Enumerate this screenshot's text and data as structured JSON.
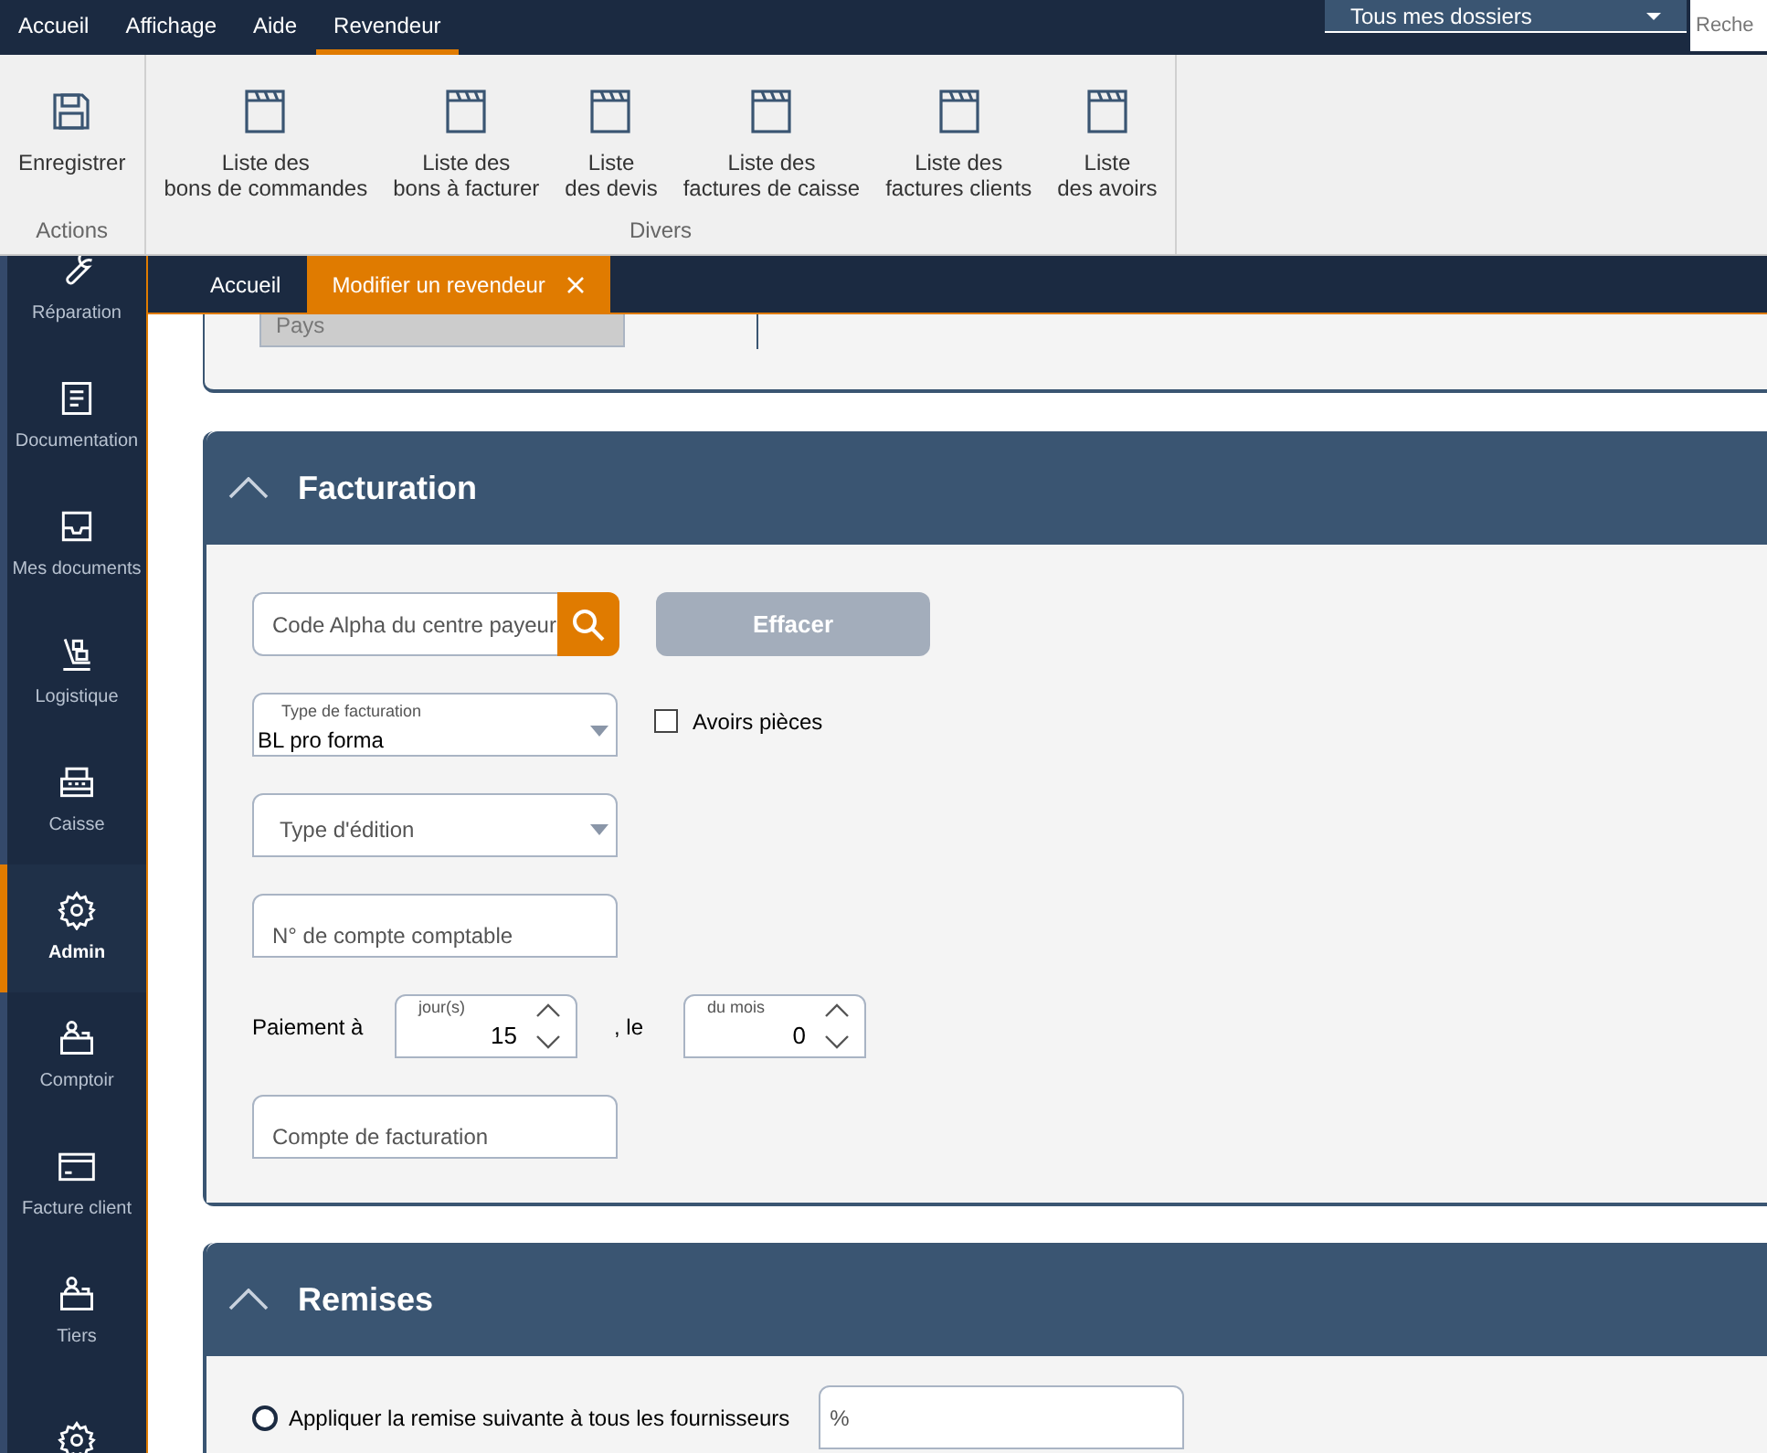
{
  "menu": [
    {
      "label": "Accueil",
      "selected": false
    },
    {
      "label": "Affichage",
      "selected": false
    },
    {
      "label": "Aide",
      "selected": false
    },
    {
      "label": "Revendeur",
      "selected": true
    }
  ],
  "folder_select": {
    "value": "Tous mes dossiers"
  },
  "search": {
    "placeholder": "Reche"
  },
  "ribbon": {
    "groups": [
      {
        "label": "Actions",
        "items": [
          {
            "kind": "save",
            "label": "Enregistrer"
          }
        ]
      },
      {
        "label": "Divers",
        "items": [
          {
            "kind": "list",
            "label": "Liste des\nbons de commandes"
          },
          {
            "kind": "list",
            "label": "Liste des\nbons à facturer"
          },
          {
            "kind": "list",
            "label": "Liste\ndes devis"
          },
          {
            "kind": "list",
            "label": "Liste des\nfactures de caisse"
          },
          {
            "kind": "list",
            "label": "Liste des\nfactures clients"
          },
          {
            "kind": "list",
            "label": "Liste\ndes avoirs"
          }
        ]
      }
    ]
  },
  "sidebar": {
    "items": [
      {
        "kind": "wrench",
        "label": "Réparation",
        "selected": false
      },
      {
        "kind": "doc",
        "label": "Documentation",
        "selected": false
      },
      {
        "kind": "inbox",
        "label": "Mes documents",
        "selected": false
      },
      {
        "kind": "trolley",
        "label": "Logistique",
        "selected": false
      },
      {
        "kind": "register",
        "label": "Caisse",
        "selected": false
      },
      {
        "kind": "gear",
        "label": "Admin",
        "selected": true
      },
      {
        "kind": "desk",
        "label": "Comptoir",
        "selected": false
      },
      {
        "kind": "card",
        "label": "Facture client",
        "selected": false
      },
      {
        "kind": "desk",
        "label": "Tiers",
        "selected": false
      },
      {
        "kind": "gear",
        "selected": false
      }
    ]
  },
  "tabs": [
    {
      "label": "Accueil",
      "selected": false,
      "closable": false
    },
    {
      "label": "Modifier un revendeur",
      "selected": true,
      "closable": true
    }
  ],
  "address_section": {
    "country_placeholder": "Pays"
  },
  "billing": {
    "title": "Facturation",
    "expanded": true,
    "payer_code": {
      "placeholder": "Code Alpha du centre payeur"
    },
    "clear_button": {
      "label": "Effacer",
      "disabled": true
    },
    "billing_type": {
      "label": "Type de facturation",
      "value": "BL pro forma"
    },
    "credit_parts": {
      "label": "Avoirs pièces",
      "checked": false
    },
    "edition_type": {
      "placeholder": "Type d'édition"
    },
    "account_number": {
      "placeholder": "N° de compte comptable"
    },
    "payment": {
      "label": "Paiement à",
      "days": {
        "label": "jour(s)",
        "value": "15"
      },
      "separator": ", le",
      "month_day": {
        "label": "du mois",
        "value": "0"
      }
    },
    "billing_account": {
      "placeholder": "Compte de facturation"
    }
  },
  "discounts": {
    "title": "Remises",
    "expanded": true,
    "apply_all": {
      "label": "Appliquer la remise suivante à tous les fournisseurs",
      "selected": false
    },
    "percent": {
      "placeholder": "%"
    }
  }
}
